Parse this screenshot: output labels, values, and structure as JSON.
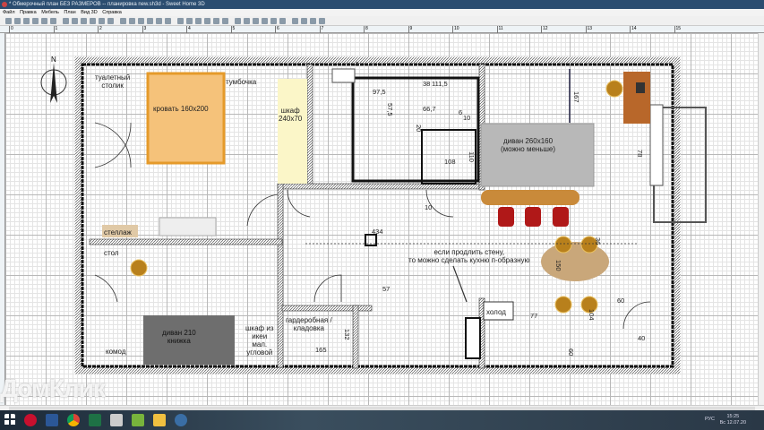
{
  "window": {
    "title": "* Обмерочный план БЕЗ РАЗМЕРОВ -- планировка new.sh3d - Sweet Home 3D"
  },
  "menu": [
    "Файл",
    "Правка",
    "Мебель",
    "План",
    "Вид 3D",
    "Справка"
  ],
  "ruler": [
    "0",
    "1",
    "2",
    "3",
    "4",
    "5",
    "6",
    "7",
    "8",
    "9",
    "10",
    "11",
    "12",
    "13",
    "14",
    "15"
  ],
  "plan": {
    "labels": {
      "vanity": "туалетный\nстолик",
      "bed": "кровать 160x200",
      "nightstand": "тумбочка",
      "wardrobe": "шкаф\n240x70",
      "shelf": "стеллаж",
      "sofa_big": "диван 260x160\n(можно меньше)",
      "note": "если продлить стену,\nто можно сделать кухню п-образную",
      "desk": "стол",
      "sofa_small": "диван 210\nкнижка",
      "dresser": "комод",
      "ikea": "шкаф из\nикеи\nмал.\nугловой",
      "closet_room": "гардеробная /\nкладовка",
      "fridge": "холод"
    },
    "dimensions": [
      "97,5",
      "111,5",
      "66,7",
      "57,5",
      "20",
      "6",
      "10",
      "108",
      "110",
      "10",
      "434",
      "167",
      "78",
      "36",
      "150",
      "60",
      "104",
      "77",
      "57",
      "165",
      "132",
      "40",
      "60",
      "4",
      "38"
    ]
  },
  "taskbar": {
    "apps": [
      "opera",
      "word",
      "chrome",
      "excel",
      "calculator",
      "utorrent",
      "explorer",
      "sweethome3d"
    ],
    "lang": "РУС",
    "time": "15:25",
    "date": "Вс 12.07.20"
  },
  "watermark": "ДомКлик",
  "colors": {
    "bed": "#f5c27a",
    "wardrobe": "#fbf6c8",
    "sofa": "#b8b8b8",
    "bar": "#c98a3a",
    "chair_red": "#b01818",
    "chair": "#b8801c",
    "table": "#c9a77a",
    "desk": "#b8672a",
    "sofa_dark": "#6e6e6e"
  }
}
